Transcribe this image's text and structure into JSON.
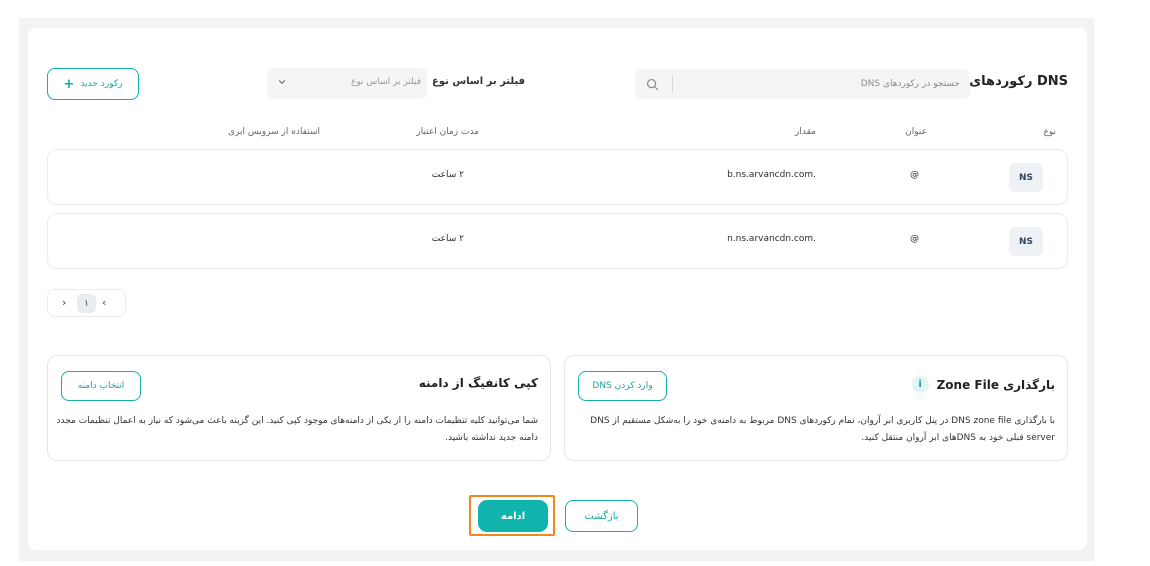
{
  "header": {
    "title": "رکوردهای DNS",
    "search_placeholder": "جستجو در رکوردهای DNS",
    "filter_label": "فیلتر بر اساس نوع",
    "filter_placeholder": "فیلتر بر اساس نوع",
    "new_record_label": "رکورد جدید",
    "plus_glyph": "+"
  },
  "table": {
    "columns": {
      "type": "نوع",
      "name": "عنوان",
      "value": "مقدار",
      "ttl": "مدت زمان اعتبار",
      "cloud": "استفاده از سرویس ابری"
    },
    "rows": [
      {
        "type": "NS",
        "name": "@",
        "value": "b.ns.arvancdn.com.",
        "ttl": "۲ ساعت"
      },
      {
        "type": "NS",
        "name": "@",
        "value": "n.ns.arvancdn.com.",
        "ttl": "۲ ساعت"
      }
    ]
  },
  "pagination": {
    "prev": "‹",
    "current": "۱",
    "next": "›"
  },
  "zone_card": {
    "title": "بارگذاری Zone File",
    "info_glyph": "i",
    "button_label": "وارد کردن DNS",
    "description": "با بارگذاری DNS zone file در پنل کاربری ابر آروان، تمام رکوردهای DNS مربوط به دامنه‌ی خود را به‌شکل مستقیم از DNS server قبلی خود به DNSهای ابر آروان منتقل کنید."
  },
  "copy_card": {
    "title": "کپی کانفیگ از دامنه",
    "button_label": "انتخاب دامنه",
    "description": "شما می‌توانید کلیه تنظیمات دامنه را از یکی از دامنه‌های موجود کپی کنید. این گزینه باعث می‌شود که نیاز به اعمال تنظیمات مجدد دامنه جدید نداشته باشید."
  },
  "footer": {
    "continue_label": "ادامه",
    "back_label": "بازگشت"
  },
  "colors": {
    "accent": "#11b3ad",
    "focus": "#f0881e"
  }
}
